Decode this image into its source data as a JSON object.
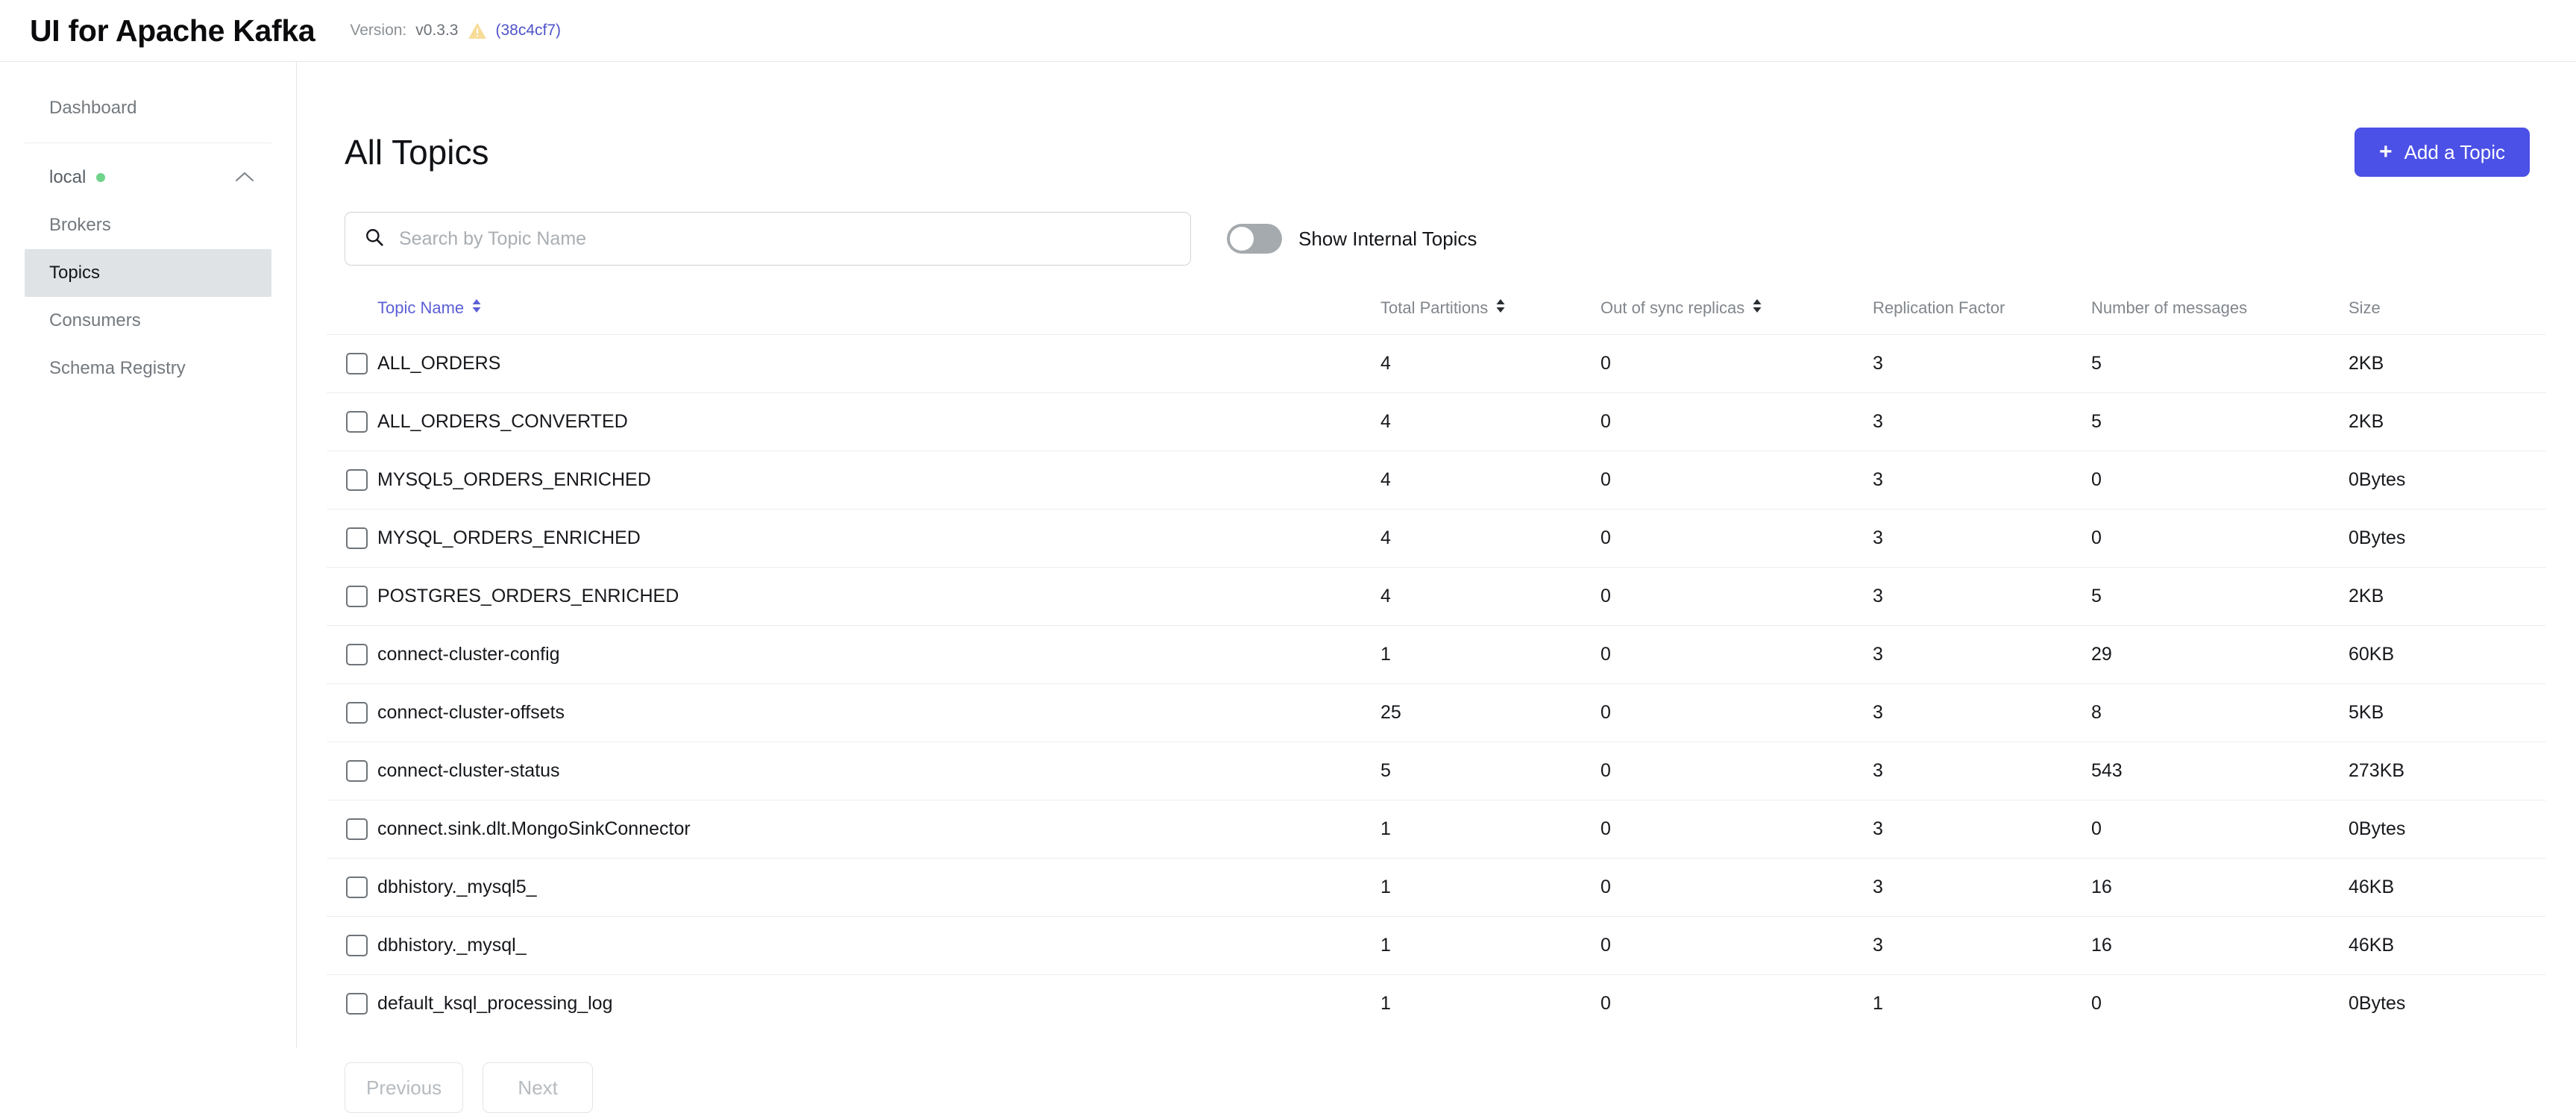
{
  "header": {
    "title": "UI for Apache Kafka",
    "version_label": "Version:",
    "version_value": "v0.3.3",
    "warning_icon": "warning-triangle-icon",
    "commit": "(38c4cf7)"
  },
  "sidebar": {
    "dashboard": "Dashboard",
    "cluster": {
      "name": "local",
      "status_dot_color": "#6fd38a",
      "chevron": "chevron-up-icon"
    },
    "items": [
      {
        "label": "Brokers",
        "active": false
      },
      {
        "label": "Topics",
        "active": true
      },
      {
        "label": "Consumers",
        "active": false
      },
      {
        "label": "Schema Registry",
        "active": false
      }
    ]
  },
  "main": {
    "page_title": "All Topics",
    "add_topic_button": "Add a Topic",
    "add_topic_icon": "plus-icon",
    "search": {
      "placeholder": "Search by Topic Name",
      "value": "",
      "icon": "search-icon"
    },
    "toggle": {
      "label": "Show Internal Topics",
      "checked": false
    },
    "pagination": {
      "previous": "Previous",
      "next": "Next",
      "previous_disabled": true,
      "next_disabled": true
    }
  },
  "colors": {
    "accent": "#4b50e6",
    "sort_header": "#5b5fd6",
    "link": "#4f52c9",
    "status_ok": "#6fd38a",
    "warning": "#f5d78e"
  },
  "table": {
    "columns": [
      {
        "label": "Topic Name",
        "sortable": true,
        "highlight": true
      },
      {
        "label": "Total Partitions",
        "sortable": true,
        "highlight": false
      },
      {
        "label": "Out of sync replicas",
        "sortable": true,
        "highlight": false
      },
      {
        "label": "Replication Factor",
        "sortable": false,
        "highlight": false
      },
      {
        "label": "Number of messages",
        "sortable": false,
        "highlight": false
      },
      {
        "label": "Size",
        "sortable": false,
        "highlight": false
      }
    ],
    "rows": [
      {
        "name": "ALL_ORDERS",
        "partitions": "4",
        "out_of_sync": "0",
        "replication": "3",
        "messages": "5",
        "size": "2KB"
      },
      {
        "name": "ALL_ORDERS_CONVERTED",
        "partitions": "4",
        "out_of_sync": "0",
        "replication": "3",
        "messages": "5",
        "size": "2KB"
      },
      {
        "name": "MYSQL5_ORDERS_ENRICHED",
        "partitions": "4",
        "out_of_sync": "0",
        "replication": "3",
        "messages": "0",
        "size": "0Bytes"
      },
      {
        "name": "MYSQL_ORDERS_ENRICHED",
        "partitions": "4",
        "out_of_sync": "0",
        "replication": "3",
        "messages": "0",
        "size": "0Bytes"
      },
      {
        "name": "POSTGRES_ORDERS_ENRICHED",
        "partitions": "4",
        "out_of_sync": "0",
        "replication": "3",
        "messages": "5",
        "size": "2KB"
      },
      {
        "name": "connect-cluster-config",
        "partitions": "1",
        "out_of_sync": "0",
        "replication": "3",
        "messages": "29",
        "size": "60KB"
      },
      {
        "name": "connect-cluster-offsets",
        "partitions": "25",
        "out_of_sync": "0",
        "replication": "3",
        "messages": "8",
        "size": "5KB"
      },
      {
        "name": "connect-cluster-status",
        "partitions": "5",
        "out_of_sync": "0",
        "replication": "3",
        "messages": "543",
        "size": "273KB"
      },
      {
        "name": "connect.sink.dlt.MongoSinkConnector",
        "partitions": "1",
        "out_of_sync": "0",
        "replication": "3",
        "messages": "0",
        "size": "0Bytes"
      },
      {
        "name": "dbhistory._mysql5_",
        "partitions": "1",
        "out_of_sync": "0",
        "replication": "3",
        "messages": "16",
        "size": "46KB"
      },
      {
        "name": "dbhistory._mysql_",
        "partitions": "1",
        "out_of_sync": "0",
        "replication": "3",
        "messages": "16",
        "size": "46KB"
      },
      {
        "name": "default_ksql_processing_log",
        "partitions": "1",
        "out_of_sync": "0",
        "replication": "1",
        "messages": "0",
        "size": "0Bytes"
      }
    ]
  }
}
